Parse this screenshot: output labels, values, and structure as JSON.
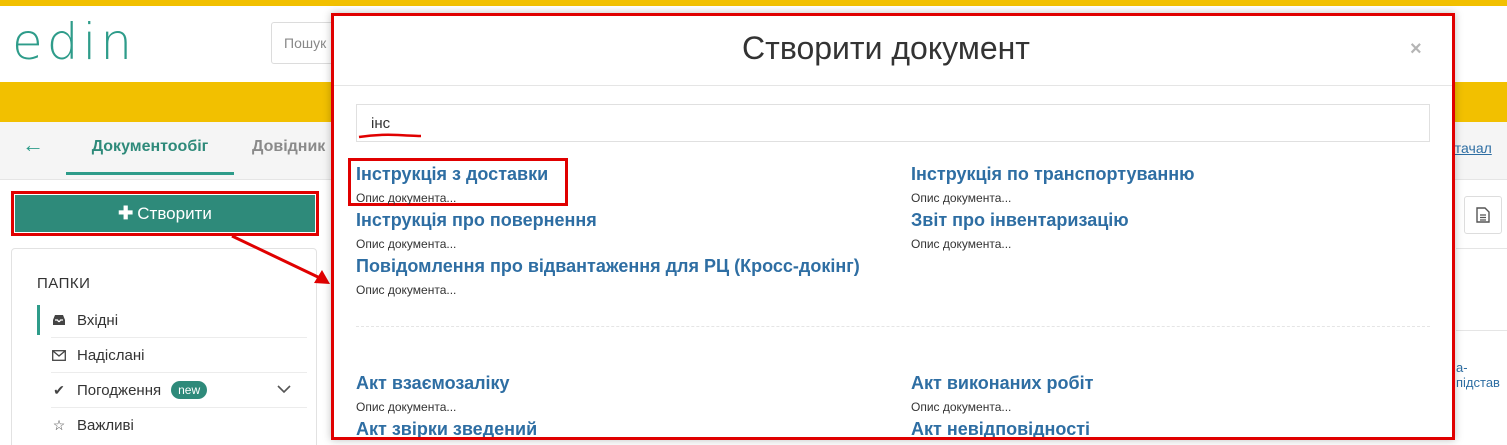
{
  "app": {
    "logo": "edin",
    "search_placeholder": "Пошук",
    "nav_tabs": [
      "Документообіг",
      "Довідник"
    ],
    "right_link_top": "остачал",
    "right_link_mid": "а-підстав"
  },
  "sidebar": {
    "create_label": "Створити",
    "folders_title": "ПАПКИ",
    "folders": [
      {
        "label": "Вхідні",
        "icon": "inbox-icon"
      },
      {
        "label": "Надіслані",
        "icon": "envelope-icon"
      },
      {
        "label": "Погодження",
        "icon": "check-icon",
        "badge": "new"
      },
      {
        "label": "Важливі",
        "icon": "star-icon"
      }
    ]
  },
  "modal": {
    "title": "Створити документ",
    "close": "×",
    "search_value": "інс",
    "results": [
      {
        "title": "Інструкція з доставки",
        "desc": "Опис документа..."
      },
      {
        "title": "Інструкція по транспортуванню",
        "desc": "Опис документа..."
      },
      {
        "title": "Інструкція про повернення",
        "desc": "Опис документа..."
      },
      {
        "title": "Звіт про інвентаризацію",
        "desc": "Опис документа..."
      },
      {
        "title": "Повідомлення про відвантаження для РЦ (Кросс-докінг)",
        "desc": "Опис документа..."
      }
    ],
    "all_docs": [
      {
        "title": "Акт взаємозаліку",
        "desc": "Опис документа..."
      },
      {
        "title": "Акт виконаних робіт",
        "desc": "Опис документа..."
      },
      {
        "title": "Акт звірки зведений",
        "desc": ""
      },
      {
        "title": "Акт невідповідності",
        "desc": ""
      }
    ]
  },
  "colors": {
    "accent_green": "#2e8a7a",
    "brand_yellow": "#f2c000",
    "link_blue": "#2e6ea3",
    "annotation_red": "#e00000"
  }
}
